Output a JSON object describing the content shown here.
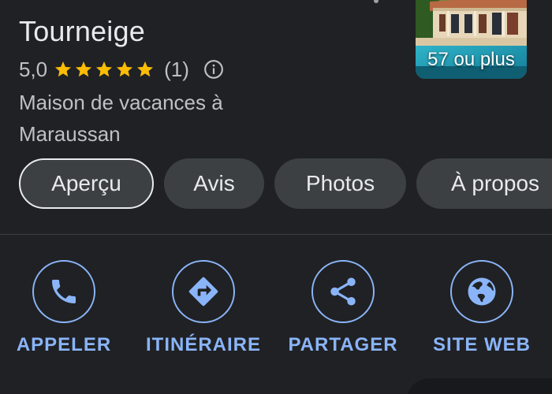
{
  "place": {
    "title": "Tourneige",
    "rating_value": "5,0",
    "star_count": 5,
    "review_count": "(1)",
    "category": "Maison de vacances à Maraussan"
  },
  "photo": {
    "count_label": "57 ou plus"
  },
  "tabs": [
    {
      "label": "Aperçu",
      "selected": true
    },
    {
      "label": "Avis",
      "selected": false
    },
    {
      "label": "Photos",
      "selected": false
    },
    {
      "label": "À propos",
      "selected": false
    }
  ],
  "actions": [
    {
      "label": "APPELER",
      "icon": "phone-icon"
    },
    {
      "label": "ITINÉRAIRE",
      "icon": "directions-icon"
    },
    {
      "label": "PARTAGER",
      "icon": "share-icon"
    },
    {
      "label": "SITE WEB",
      "icon": "globe-icon"
    }
  ],
  "colors": {
    "background": "#202124",
    "accent": "#8ab4f8",
    "star": "#fbbc04",
    "chip": "#3c4043"
  }
}
